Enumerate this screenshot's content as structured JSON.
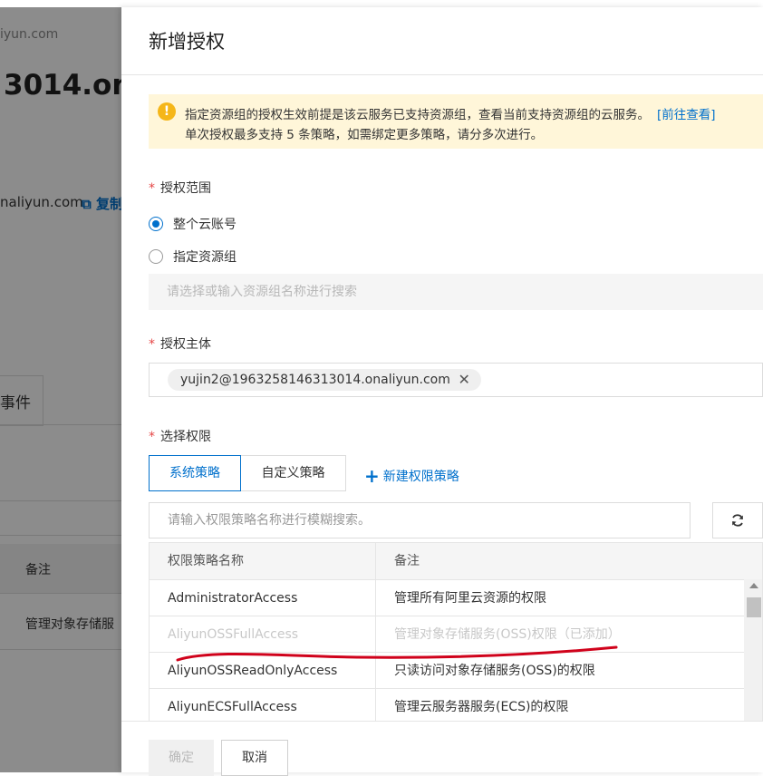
{
  "background": {
    "host_fragment": "iyun.com",
    "title_fragment": "3014.ona",
    "url_fragment": "naliyun.com",
    "copy_label": "复制",
    "tab_fragment": "事件",
    "table_header_note": "备注",
    "table_cell": "管理对象存储服"
  },
  "drawer": {
    "title": "新增授权",
    "notice": {
      "line1": "指定资源组的授权生效前提是该云服务已支持资源组，查看当前支持资源组的云服务。",
      "link": "[前往查看]",
      "line2": "单次授权最多支持 5 条策略，如需绑定更多策略，请分多次进行。"
    },
    "scope": {
      "label": "授权范围",
      "options": [
        "整个云账号",
        "指定资源组"
      ],
      "selected": "整个云账号",
      "resource_group_placeholder": "请选择或输入资源组名称进行搜索"
    },
    "principal": {
      "label": "授权主体",
      "tag": "yujin2@1963258146313014.onaliyun.com"
    },
    "permissions": {
      "label": "选择权限",
      "tabs": [
        "系统策略",
        "自定义策略"
      ],
      "active_tab": "系统策略",
      "new_policy_label": "新建权限策略",
      "search_placeholder": "请输入权限策略名称进行模糊搜索。",
      "columns": [
        "权限策略名称",
        "备注"
      ],
      "rows": [
        {
          "name": "AdministratorAccess",
          "note": "管理所有阿里云资源的权限"
        },
        {
          "name": "AliyunOSSFullAccess",
          "note": "管理对象存储服务(OSS)权限（已添加）"
        },
        {
          "name": "AliyunOSSReadOnlyAccess",
          "note": "只读访问对象存储服务(OSS)的权限"
        },
        {
          "name": "AliyunECSFullAccess",
          "note": "管理云服务器服务(ECS)的权限"
        }
      ]
    },
    "footer": {
      "ok_label": "确定",
      "cancel_label": "取消"
    }
  },
  "colors": {
    "accent": "#0070cc",
    "required": "#e54545",
    "warning_bg": "#fff6d9",
    "warning_icon": "#f5b619",
    "annotation_red": "#d0021b"
  }
}
